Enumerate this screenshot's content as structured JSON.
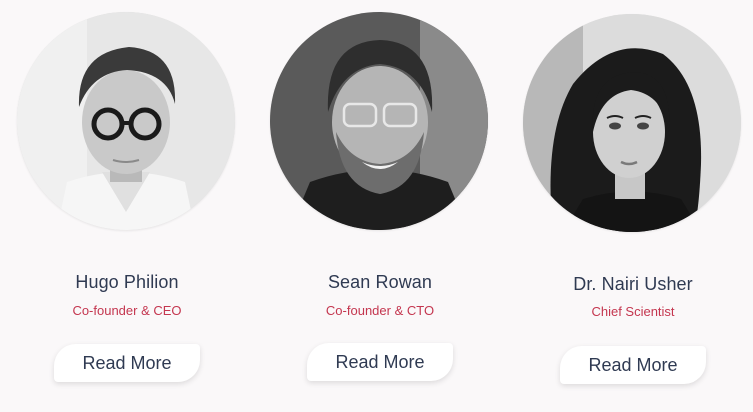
{
  "team": {
    "members": [
      {
        "name": "Hugo Philion",
        "role": "Co-founder & CEO",
        "button": "Read More"
      },
      {
        "name": "Sean Rowan",
        "role": "Co-founder & CTO",
        "button": "Read More"
      },
      {
        "name": "Dr. Nairi Usher",
        "role": "Chief Scientist",
        "button": "Read More"
      }
    ]
  },
  "colors": {
    "name_text": "#2f3a52",
    "role_text": "#c4364f",
    "background": "#faf8f9"
  }
}
